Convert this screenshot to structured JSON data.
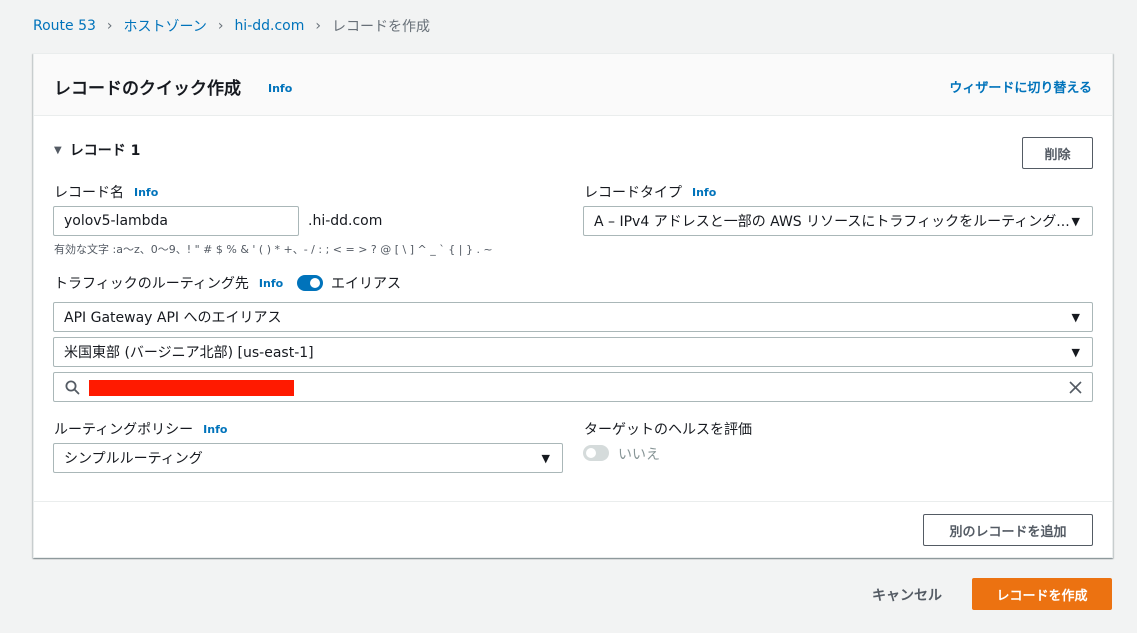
{
  "breadcrumb": {
    "items": [
      "Route 53",
      "ホストゾーン",
      "hi-dd.com"
    ],
    "current": "レコードを作成",
    "separator": "›"
  },
  "panel": {
    "title": "レコードのクイック作成",
    "info": "Info",
    "wizard_link": "ウィザードに切り替える"
  },
  "record": {
    "toggle_label": "レコード 1",
    "delete_label": "削除",
    "name_label": "レコード名",
    "name_info": "Info",
    "name_value": "yolov5-lambda",
    "domain_suffix": ".hi-dd.com",
    "valid_chars_hint": "有効な文字 :a〜z、0〜9、! \" # $ % & ' ( ) * +、- / : ; < = > ? @ [ \\ ] ^ _ ` { | } . ~",
    "type_label": "レコードタイプ",
    "type_info": "Info",
    "type_value": "A – IPv4 アドレスと一部の AWS リソースにトラフィックをルーティング...",
    "route_label": "トラフィックのルーティング先",
    "route_info": "Info",
    "alias_label": "エイリアス",
    "alias_enabled": true,
    "endpoint_value": "API Gateway API へのエイリアス",
    "region_value": "米国東部 (バージニア北部) [us-east-1]",
    "policy_label": "ルーティングポリシー",
    "policy_info": "Info",
    "policy_value": "シンプルルーティング",
    "health_label": "ターゲットのヘルスを評価",
    "health_value": "いいえ",
    "health_enabled": false
  },
  "add_record_label": "別のレコードを追加",
  "actions": {
    "cancel_label": "キャンセル",
    "create_label": "レコードを作成"
  },
  "icons": {
    "caret": "caret-down-icon",
    "dropdown": "dropdown-arrow-icon",
    "search": "search-icon",
    "clear": "close-icon"
  },
  "colors": {
    "link": "#0073bb",
    "primary_button": "#ec7211",
    "toggle_on": "#0073bb",
    "redaction": "#ff1a00"
  }
}
